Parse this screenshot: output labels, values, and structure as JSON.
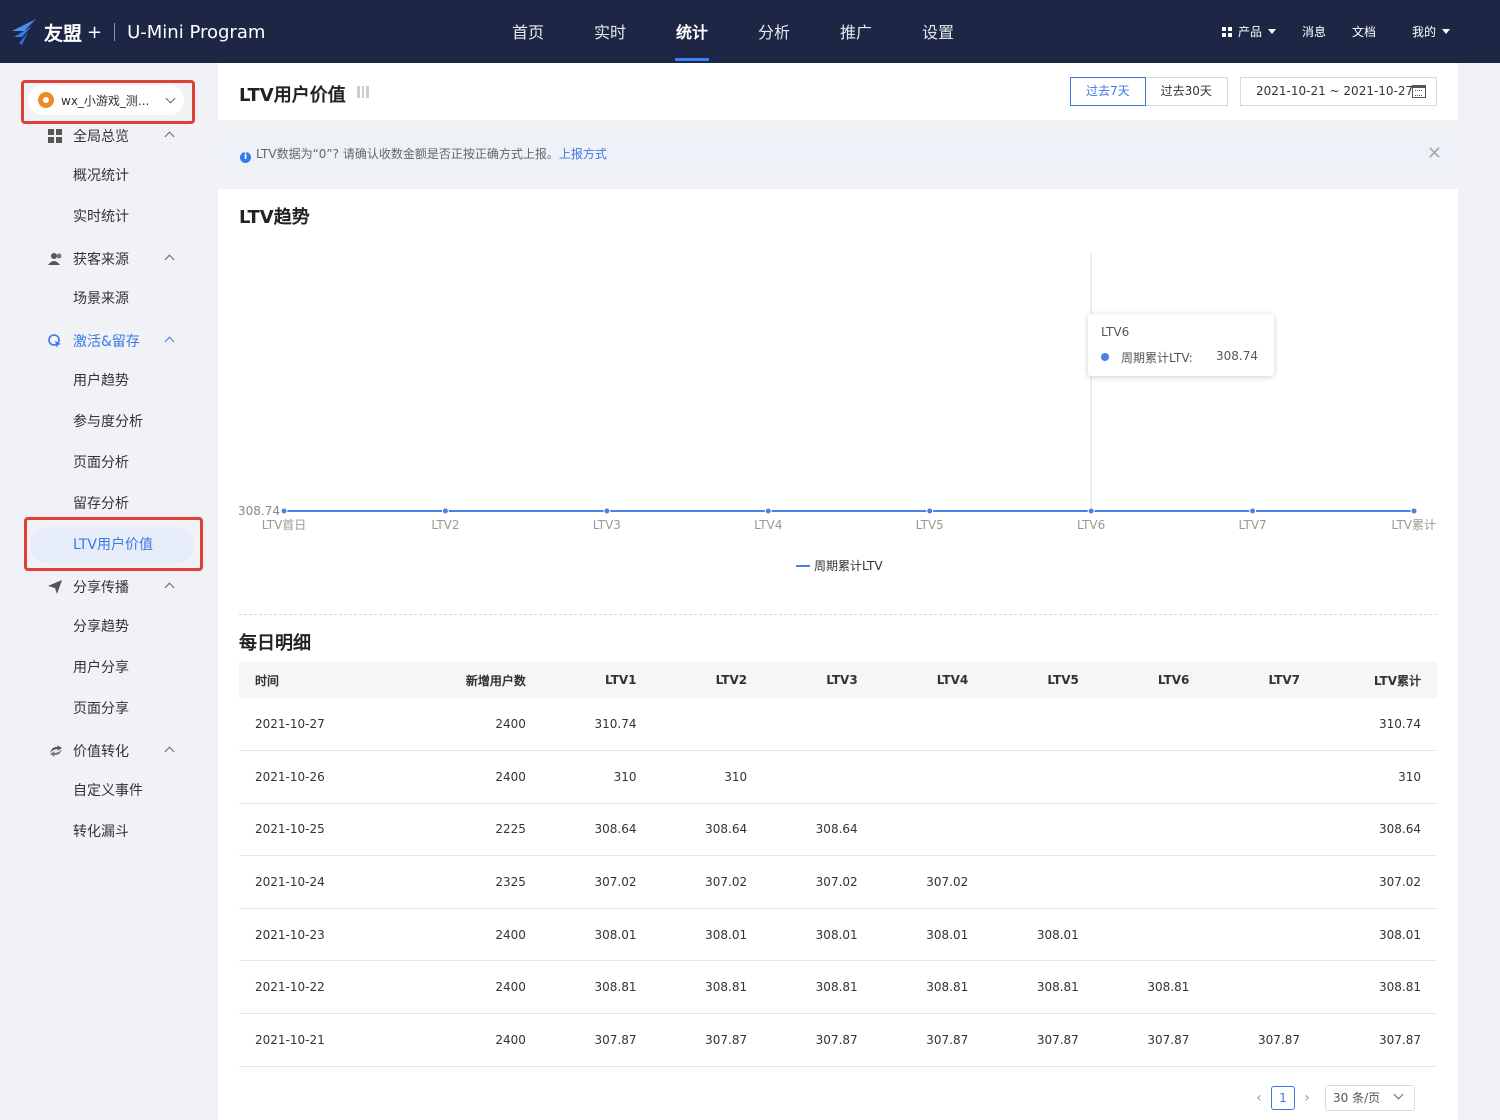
{
  "brand": {
    "name": "友盟",
    "plus": "+",
    "product": "U-Mini Program"
  },
  "nav": {
    "items": [
      {
        "label": "首页",
        "active": false
      },
      {
        "label": "实时",
        "active": false
      },
      {
        "label": "统计",
        "active": true
      },
      {
        "label": "分析",
        "active": false
      },
      {
        "label": "推广",
        "active": false
      },
      {
        "label": "设置",
        "active": false
      }
    ],
    "right": {
      "products": "产品",
      "messages": "消息",
      "docs": "文档",
      "mine": "我的"
    }
  },
  "sidebar": {
    "app_select": "wx_小游戏_测...",
    "groups": [
      {
        "label": "全局总览",
        "icon": "dashboard-icon",
        "items": [
          "概况统计",
          "实时统计"
        ]
      },
      {
        "label": "获客来源",
        "icon": "users-icon",
        "items": [
          "场景来源"
        ]
      },
      {
        "label": "激活&留存",
        "icon": "activation-icon",
        "active": true,
        "items": [
          "用户趋势",
          "参与度分析",
          "页面分析",
          "留存分析",
          "LTV用户价值"
        ]
      },
      {
        "label": "分享传播",
        "icon": "share-icon",
        "items": [
          "分享趋势",
          "用户分享",
          "页面分享"
        ]
      },
      {
        "label": "价值转化",
        "icon": "conversion-icon",
        "items": [
          "自定义事件",
          "转化漏斗"
        ]
      }
    ],
    "active_item": "LTV用户价值"
  },
  "header": {
    "title": "LTV用户价值",
    "range_buttons": [
      {
        "label": "过去7天",
        "active": true
      },
      {
        "label": "过去30天",
        "active": false
      }
    ],
    "date_range": "2021-10-21 ~ 2021-10-27"
  },
  "notice": {
    "text": "LTV数据为“0”? 请确认收数金额是否正按正确方式上报。",
    "link": "上报方式"
  },
  "trend": {
    "title": "LTV趋势",
    "tooltip": {
      "title": "LTV6",
      "series": "周期累计LTV:",
      "value": "308.74"
    }
  },
  "chart_data": {
    "type": "line",
    "title": "LTV趋势",
    "x": [
      "LTV首日",
      "LTV2",
      "LTV3",
      "LTV4",
      "LTV5",
      "LTV6",
      "LTV7",
      "LTV累计"
    ],
    "series": [
      {
        "name": "周期累计LTV",
        "values": [
          308.74,
          308.74,
          308.74,
          308.74,
          308.74,
          308.74,
          308.74,
          308.74
        ]
      }
    ],
    "y_ticks": [
      "308.74"
    ],
    "legend": "bottom-center",
    "highlight_index": 5,
    "color": "#4a7fe5"
  },
  "detail": {
    "title": "每日明细",
    "columns": [
      "时间",
      "新增用户数",
      "LTV1",
      "LTV2",
      "LTV3",
      "LTV4",
      "LTV5",
      "LTV6",
      "LTV7",
      "LTV累计"
    ],
    "rows": [
      [
        "2021-10-27",
        "2400",
        "310.74",
        "",
        "",
        "",
        "",
        "",
        "",
        "310.74"
      ],
      [
        "2021-10-26",
        "2400",
        "310",
        "310",
        "",
        "",
        "",
        "",
        "",
        "310"
      ],
      [
        "2021-10-25",
        "2225",
        "308.64",
        "308.64",
        "308.64",
        "",
        "",
        "",
        "",
        "308.64"
      ],
      [
        "2021-10-24",
        "2325",
        "307.02",
        "307.02",
        "307.02",
        "307.02",
        "",
        "",
        "",
        "307.02"
      ],
      [
        "2021-10-23",
        "2400",
        "308.01",
        "308.01",
        "308.01",
        "308.01",
        "308.01",
        "",
        "",
        "308.01"
      ],
      [
        "2021-10-22",
        "2400",
        "308.81",
        "308.81",
        "308.81",
        "308.81",
        "308.81",
        "308.81",
        "",
        "308.81"
      ],
      [
        "2021-10-21",
        "2400",
        "307.87",
        "307.87",
        "307.87",
        "307.87",
        "307.87",
        "307.87",
        "307.87",
        "307.87"
      ]
    ]
  },
  "pager": {
    "page": "1",
    "page_size": "30 条/页"
  }
}
